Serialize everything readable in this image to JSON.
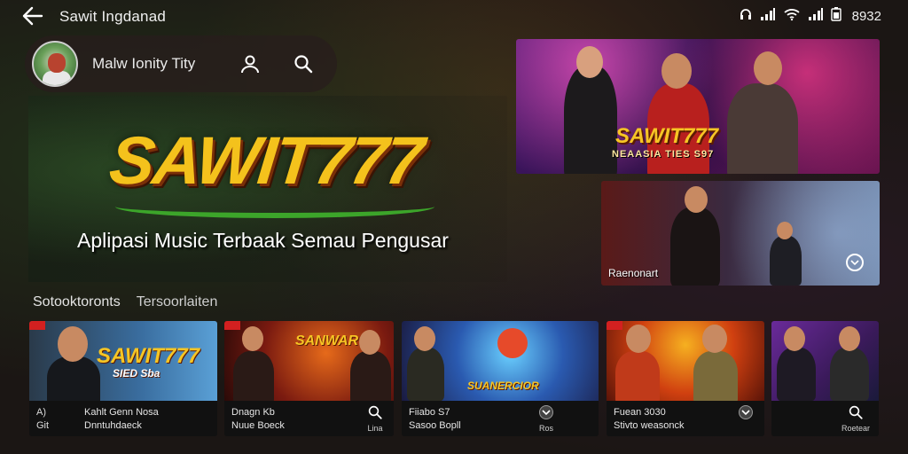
{
  "status_bar": {
    "app_title": "Sawit Ingdanad",
    "time": "8932"
  },
  "profile": {
    "name": "Malw Ionity Tity"
  },
  "hero": {
    "logo": "SAWIT777",
    "tagline": "Aplipasi Music Terbaak Semau Pengusar"
  },
  "banners": {
    "top": {
      "logo": "SAWIT777",
      "subtitle": "NEAASIA TIES S97"
    },
    "bottom": {
      "caption": "Raenonart"
    }
  },
  "tabs": [
    "Sotooktoronts",
    "Tersoorlaiten"
  ],
  "cards": [
    {
      "art_title": "SAWIT777",
      "art_sub": "SIED Sba",
      "left_top": "A)",
      "left_bottom": "Git",
      "line1": "Kahlt Genn Nosa",
      "line2": "Dnntuhdaeck",
      "right_top": "",
      "right_bottom": ""
    },
    {
      "art_title": "SANWAR",
      "art_sub": "",
      "left_top": "",
      "left_bottom": "",
      "line1": "Dnagn Kb",
      "line2": "Nuue Boeck",
      "right_top": "",
      "right_bottom": "Lina"
    },
    {
      "art_title": "SUANERCIOR",
      "art_sub": "",
      "left_top": "",
      "left_bottom": "",
      "line1": "Fiiabo S7",
      "line2": "Sasoo Bopll",
      "right_top": "",
      "right_bottom": "Ros"
    },
    {
      "art_title": "",
      "art_sub": "",
      "left_top": "",
      "left_bottom": "",
      "line1": "Fuean 3030",
      "line2": "Stivto weasonck",
      "right_top": "",
      "right_bottom": ""
    },
    {
      "art_title": "",
      "art_sub": "",
      "left_top": "",
      "left_bottom": "",
      "line1": "",
      "line2": "",
      "right_top": "",
      "right_bottom": "Roetear"
    }
  ],
  "colors": {
    "logo_gold": "#f4c21c",
    "accent_green": "#3ca52a",
    "background": "#1b1614"
  },
  "icons": [
    "back-arrow-icon",
    "user-icon",
    "search-icon",
    "signal-icon",
    "wifi-icon",
    "battery-icon",
    "chevron-down-icon"
  ]
}
